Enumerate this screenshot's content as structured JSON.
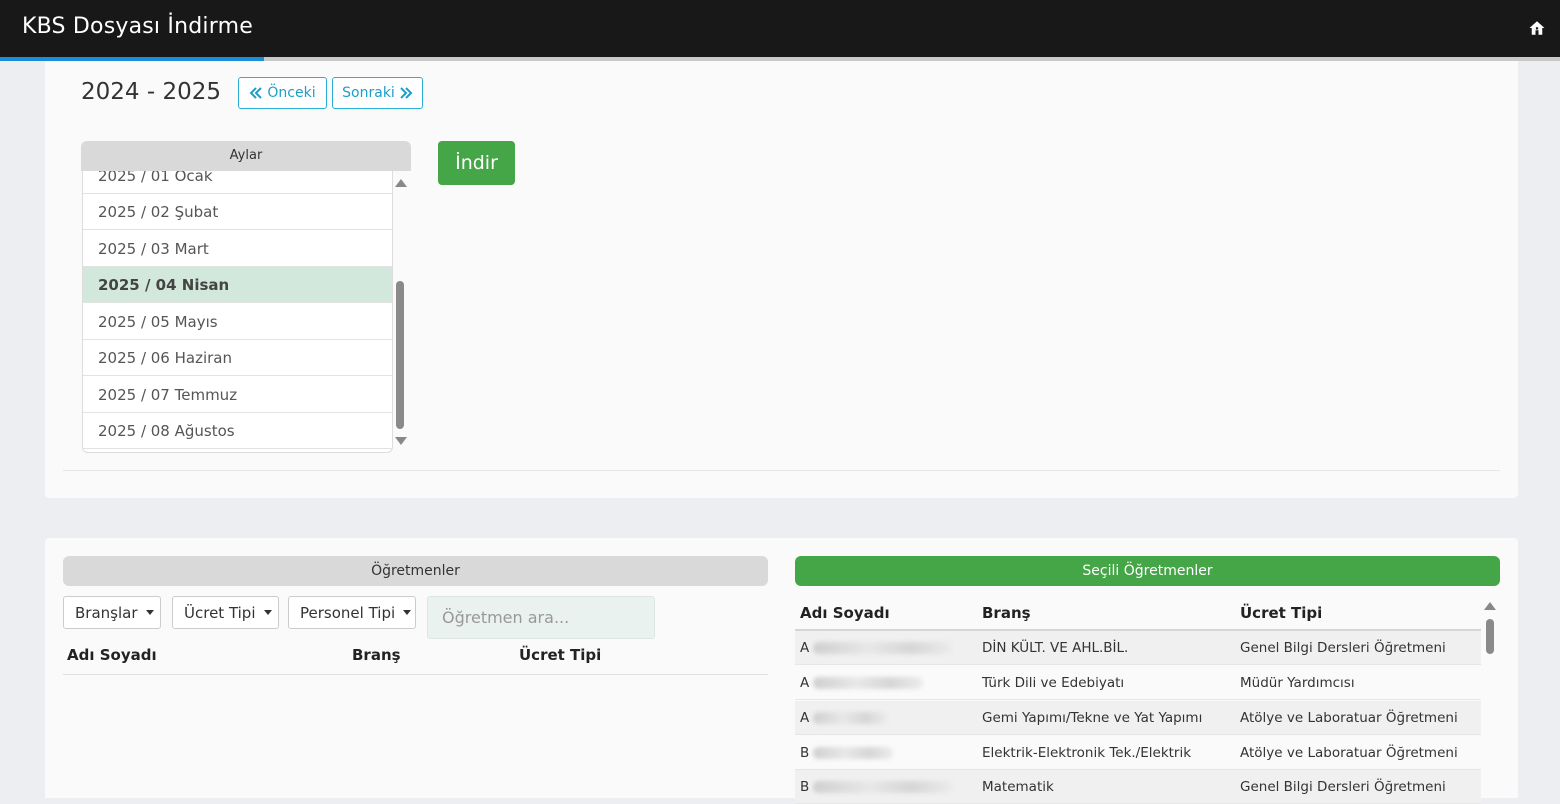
{
  "app": {
    "title": "KBS Dosyası İndirme",
    "home_icon": "home-icon"
  },
  "period": {
    "year": "2024 - 2025",
    "prev_label": "Önceki",
    "next_label": "Sonraki"
  },
  "months": {
    "header": "Aylar",
    "items": [
      "2025 / 01 Ocak",
      "2025 / 02 Şubat",
      "2025 / 03 Mart",
      "2025 / 04 Nisan",
      "2025 / 05 Mayıs",
      "2025 / 06 Haziran",
      "2025 / 07 Temmuz",
      "2025 / 08 Ağustos"
    ],
    "selected": "2025 / 04 Nisan"
  },
  "download_label": "İndir",
  "teachers": {
    "header": "Öğretmenler",
    "filters": [
      "Branşlar",
      "Ücret Tipi",
      "Personel Tipi"
    ],
    "search_placeholder": "Öğretmen ara...",
    "columns": [
      "Adı Soyadı",
      "Branş",
      "Ücret Tipi"
    ]
  },
  "selected_teachers": {
    "header": "Seçili Öğretmenler",
    "columns": [
      "Adı Soyadı",
      "Branş",
      "Ücret Tipi"
    ],
    "rows": [
      {
        "initial": "A",
        "branch": "DİN KÜLT. VE AHL.BİL.",
        "pay_type": "Genel Bilgi Dersleri Öğretmeni"
      },
      {
        "initial": "A",
        "branch": "Türk Dili ve Edebiyatı",
        "pay_type": "Müdür Yardımcısı"
      },
      {
        "initial": "A",
        "branch": "Gemi Yapımı/Tekne ve Yat Yapımı",
        "pay_type": "Atölye ve Laboratuar Öğretmeni"
      },
      {
        "initial": "B",
        "branch": "Elektrik-Elektronik Tek./Elektrik",
        "pay_type": "Atölye ve Laboratuar Öğretmeni"
      },
      {
        "initial": "B",
        "branch": "Matematik",
        "pay_type": "Genel Bilgi Dersleri Öğretmeni"
      }
    ]
  }
}
